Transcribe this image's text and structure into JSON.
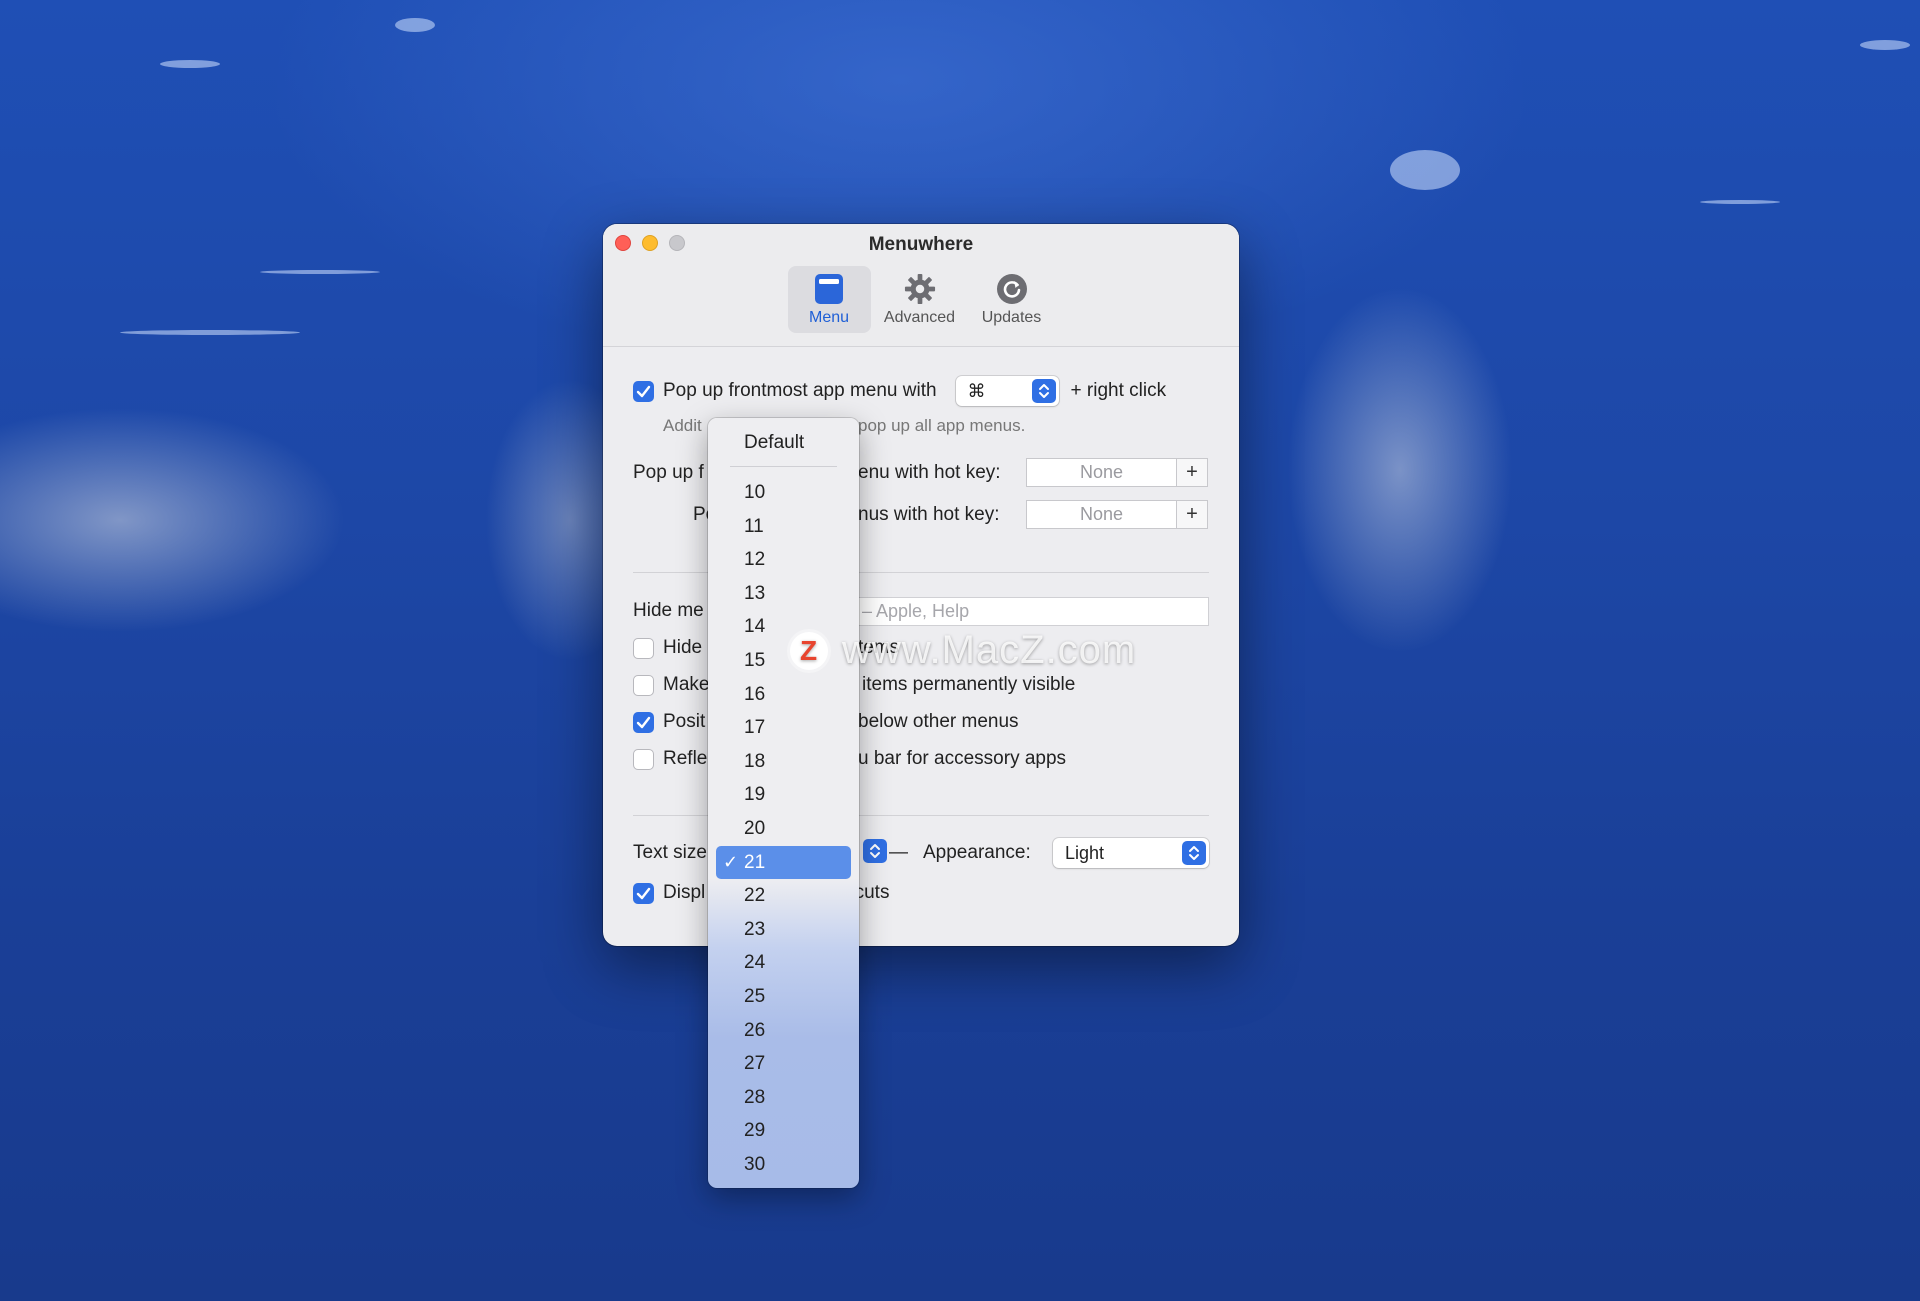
{
  "window": {
    "title": "Menuwhere"
  },
  "toolbar": {
    "items": [
      {
        "label": "Menu",
        "icon": "menu-icon",
        "active": true
      },
      {
        "label": "Advanced",
        "icon": "gear-icon",
        "active": false
      },
      {
        "label": "Updates",
        "icon": "refresh-icon",
        "active": false
      }
    ]
  },
  "settings": {
    "popup_frontmost": {
      "checked": true,
      "label": "Pop up frontmost app menu with",
      "modifier": "⌘",
      "suffix": "+ right click"
    },
    "hint": {
      "left": "Addit",
      "right": "pop up all app menus."
    },
    "hotkey1": {
      "label_left": "Pop up f",
      "label_right": "enu with hot key:",
      "value": "None",
      "add": "+"
    },
    "hotkey2": {
      "label_left": "Po",
      "label_right": "nus with hot key:",
      "value": "None",
      "add": "+"
    },
    "hide_menus": {
      "label": "Hide me",
      "placeholder": "– Apple, Help"
    },
    "options": [
      {
        "checked": false,
        "left": "Hide",
        "right": "tems"
      },
      {
        "checked": false,
        "left": "Make",
        "right": "items permanently visible"
      },
      {
        "checked": true,
        "left": "Posit",
        "right": "below other menus"
      },
      {
        "checked": false,
        "left": "Refle",
        "right": "u bar for accessory apps"
      }
    ],
    "text_size": {
      "label": "Text size",
      "dash": "—"
    },
    "appearance": {
      "label": "Appearance:",
      "value": "Light"
    },
    "display_shortcuts": {
      "checked": true,
      "left": "Displ",
      "right": "rtcuts"
    }
  },
  "dropdown": {
    "default_label": "Default",
    "options": [
      "10",
      "11",
      "12",
      "13",
      "14",
      "15",
      "16",
      "17",
      "18",
      "19",
      "20",
      "21",
      "22",
      "23",
      "24",
      "25",
      "26",
      "27",
      "28",
      "29",
      "30"
    ],
    "selected": "21",
    "check_mark": "✓"
  },
  "watermark": {
    "text": "www.MacZ.com",
    "logo_letter": "Z"
  },
  "colors": {
    "accent": "#2f6fe4",
    "selection": "#5b8fe9",
    "close": "#ff5f57",
    "minimize": "#febc2e"
  }
}
